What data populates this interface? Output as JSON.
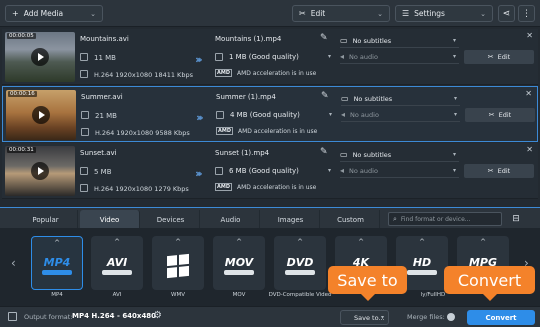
{
  "toolbar": {
    "add_media": "Add Media",
    "edit": "Edit",
    "settings": "Settings"
  },
  "files": [
    {
      "duration": "00:00:05",
      "name": "Mountains.avi",
      "size": "11 MB",
      "info": "H.264 1920x1080 18411 Kbps",
      "output_name": "Mountains (1).mp4",
      "output_size": "1 MB (Good quality)",
      "acceleration": "AMD acceleration is in use",
      "subtitles": "No subtitles",
      "audio": "No audio",
      "edit": "Edit"
    },
    {
      "duration": "00:00:16",
      "name": "Summer.avi",
      "size": "21 MB",
      "info": "H.264 1920x1080 9588 Kbps",
      "output_name": "Summer (1).mp4",
      "output_size": "4 MB (Good quality)",
      "acceleration": "AMD acceleration is in use",
      "subtitles": "No subtitles",
      "audio": "No audio",
      "edit": "Edit"
    },
    {
      "duration": "00:00:31",
      "name": "Sunset.avi",
      "size": "5 MB",
      "info": "H.264 1920x1080 1279 Kbps",
      "output_name": "Sunset (1).mp4",
      "output_size": "6 MB (Good quality)",
      "acceleration": "AMD acceleration is in use",
      "subtitles": "No subtitles",
      "audio": "No audio",
      "edit": "Edit"
    }
  ],
  "format_tabs": [
    "Popular",
    "Video",
    "Devices",
    "Audio",
    "Images",
    "Custom"
  ],
  "active_tab": "Video",
  "format_search": {
    "placeholder": "Find format or device..."
  },
  "formats": [
    {
      "logo": "MP4",
      "label": "MP4"
    },
    {
      "logo": "AVI",
      "label": "AVI"
    },
    {
      "logo": "",
      "label": "WMV"
    },
    {
      "logo": "MOV",
      "label": "MOV"
    },
    {
      "logo": "DVD",
      "label": "DVD-Compatible Video"
    },
    {
      "logo": "4K",
      "label": ""
    },
    {
      "logo": "HD",
      "label": "ly/FullHD"
    },
    {
      "logo": "MPG",
      "label": ""
    }
  ],
  "callouts": {
    "save_to": "Save to",
    "convert": "Convert"
  },
  "bottom": {
    "output_format_label": "Output format:",
    "output_format_value": "MP4 H.264 - 640x480",
    "save_to": "Save to...",
    "merge_files": "Merge files:",
    "convert": "Convert"
  },
  "colors": {
    "accent": "#2e8de8",
    "callout": "#f4822a",
    "background": "#232a31"
  }
}
